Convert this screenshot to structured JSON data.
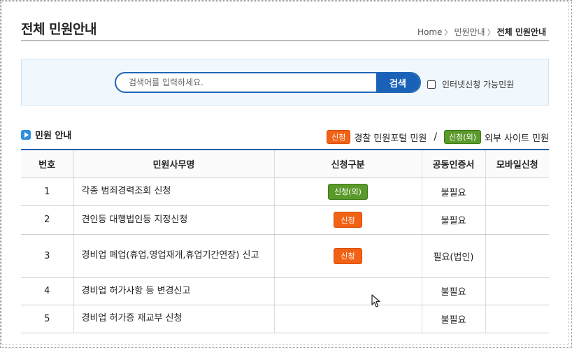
{
  "page": {
    "title": "전체 민원안내",
    "breadcrumb": [
      "Home",
      "민원안내",
      "전체 민원안내"
    ]
  },
  "search": {
    "placeholder": "검색어를 입력하세요.",
    "button_label": "검색",
    "online_only_label": "인터넷신청 가능민원",
    "online_only_checked": false
  },
  "section": {
    "title": "민원 안내",
    "legend": [
      {
        "badge": "신청",
        "label": "경찰 민원포털 민원",
        "color": "#f26214"
      },
      {
        "badge": "신청(외)",
        "label": "외부 사이트 민원",
        "color": "#5a9a2b"
      }
    ],
    "legend_separator": "/"
  },
  "table": {
    "columns": [
      "번호",
      "민원사무명",
      "신청구분",
      "공동인증서",
      "모바일신청"
    ],
    "rows": [
      {
        "no": "1",
        "name": "각종 범죄경력조회 신청",
        "apply": "신청(외)",
        "apply_type": "external",
        "cert": "불필요",
        "mobile": ""
      },
      {
        "no": "2",
        "name": "견인등 대행법인등 지정신청",
        "apply": "신청",
        "apply_type": "portal",
        "cert": "불필요",
        "mobile": ""
      },
      {
        "no": "3",
        "name": "경비업 폐업(휴업,영업재개,휴업기간연장) 신고",
        "apply": "신청",
        "apply_type": "portal",
        "cert": "필요(법인)",
        "mobile": ""
      },
      {
        "no": "4",
        "name": "경비업 허가사항 등 변경신고",
        "apply": "",
        "apply_type": "none",
        "cert": "불필요",
        "mobile": ""
      },
      {
        "no": "5",
        "name": "경비업 허가증 재교부 신청",
        "apply": "",
        "apply_type": "none",
        "cert": "불필요",
        "mobile": ""
      }
    ]
  },
  "colors": {
    "accent": "#1a62b8",
    "portal_badge": "#f26214",
    "external_badge": "#5a9a2b",
    "search_bg": "#f1f8fd"
  }
}
